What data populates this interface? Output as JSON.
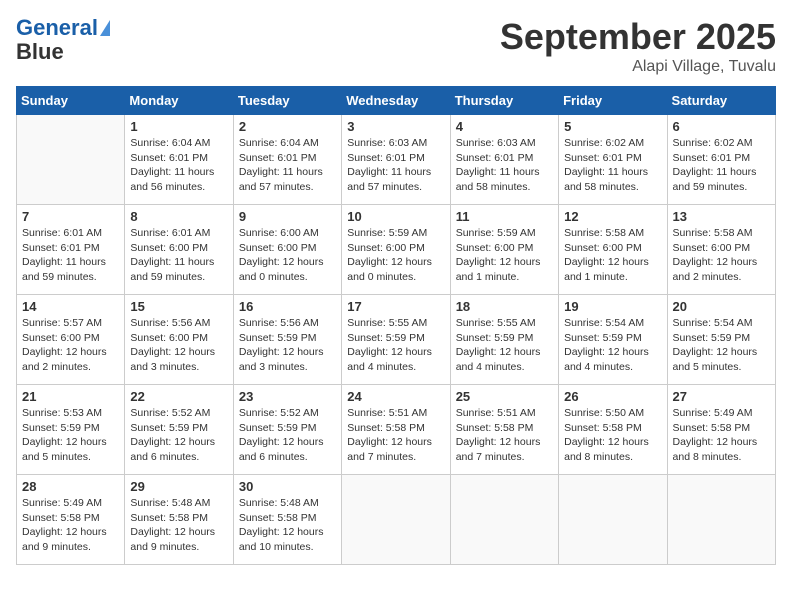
{
  "header": {
    "logo_line1": "General",
    "logo_line2": "Blue",
    "month": "September 2025",
    "location": "Alapi Village, Tuvalu"
  },
  "weekdays": [
    "Sunday",
    "Monday",
    "Tuesday",
    "Wednesday",
    "Thursday",
    "Friday",
    "Saturday"
  ],
  "weeks": [
    [
      {
        "day": null,
        "info": null
      },
      {
        "day": "1",
        "info": "Sunrise: 6:04 AM\nSunset: 6:01 PM\nDaylight: 11 hours\nand 56 minutes."
      },
      {
        "day": "2",
        "info": "Sunrise: 6:04 AM\nSunset: 6:01 PM\nDaylight: 11 hours\nand 57 minutes."
      },
      {
        "day": "3",
        "info": "Sunrise: 6:03 AM\nSunset: 6:01 PM\nDaylight: 11 hours\nand 57 minutes."
      },
      {
        "day": "4",
        "info": "Sunrise: 6:03 AM\nSunset: 6:01 PM\nDaylight: 11 hours\nand 58 minutes."
      },
      {
        "day": "5",
        "info": "Sunrise: 6:02 AM\nSunset: 6:01 PM\nDaylight: 11 hours\nand 58 minutes."
      },
      {
        "day": "6",
        "info": "Sunrise: 6:02 AM\nSunset: 6:01 PM\nDaylight: 11 hours\nand 59 minutes."
      }
    ],
    [
      {
        "day": "7",
        "info": "Sunrise: 6:01 AM\nSunset: 6:01 PM\nDaylight: 11 hours\nand 59 minutes."
      },
      {
        "day": "8",
        "info": "Sunrise: 6:01 AM\nSunset: 6:00 PM\nDaylight: 11 hours\nand 59 minutes."
      },
      {
        "day": "9",
        "info": "Sunrise: 6:00 AM\nSunset: 6:00 PM\nDaylight: 12 hours\nand 0 minutes."
      },
      {
        "day": "10",
        "info": "Sunrise: 5:59 AM\nSunset: 6:00 PM\nDaylight: 12 hours\nand 0 minutes."
      },
      {
        "day": "11",
        "info": "Sunrise: 5:59 AM\nSunset: 6:00 PM\nDaylight: 12 hours\nand 1 minute."
      },
      {
        "day": "12",
        "info": "Sunrise: 5:58 AM\nSunset: 6:00 PM\nDaylight: 12 hours\nand 1 minute."
      },
      {
        "day": "13",
        "info": "Sunrise: 5:58 AM\nSunset: 6:00 PM\nDaylight: 12 hours\nand 2 minutes."
      }
    ],
    [
      {
        "day": "14",
        "info": "Sunrise: 5:57 AM\nSunset: 6:00 PM\nDaylight: 12 hours\nand 2 minutes."
      },
      {
        "day": "15",
        "info": "Sunrise: 5:56 AM\nSunset: 6:00 PM\nDaylight: 12 hours\nand 3 minutes."
      },
      {
        "day": "16",
        "info": "Sunrise: 5:56 AM\nSunset: 5:59 PM\nDaylight: 12 hours\nand 3 minutes."
      },
      {
        "day": "17",
        "info": "Sunrise: 5:55 AM\nSunset: 5:59 PM\nDaylight: 12 hours\nand 4 minutes."
      },
      {
        "day": "18",
        "info": "Sunrise: 5:55 AM\nSunset: 5:59 PM\nDaylight: 12 hours\nand 4 minutes."
      },
      {
        "day": "19",
        "info": "Sunrise: 5:54 AM\nSunset: 5:59 PM\nDaylight: 12 hours\nand 4 minutes."
      },
      {
        "day": "20",
        "info": "Sunrise: 5:54 AM\nSunset: 5:59 PM\nDaylight: 12 hours\nand 5 minutes."
      }
    ],
    [
      {
        "day": "21",
        "info": "Sunrise: 5:53 AM\nSunset: 5:59 PM\nDaylight: 12 hours\nand 5 minutes."
      },
      {
        "day": "22",
        "info": "Sunrise: 5:52 AM\nSunset: 5:59 PM\nDaylight: 12 hours\nand 6 minutes."
      },
      {
        "day": "23",
        "info": "Sunrise: 5:52 AM\nSunset: 5:59 PM\nDaylight: 12 hours\nand 6 minutes."
      },
      {
        "day": "24",
        "info": "Sunrise: 5:51 AM\nSunset: 5:58 PM\nDaylight: 12 hours\nand 7 minutes."
      },
      {
        "day": "25",
        "info": "Sunrise: 5:51 AM\nSunset: 5:58 PM\nDaylight: 12 hours\nand 7 minutes."
      },
      {
        "day": "26",
        "info": "Sunrise: 5:50 AM\nSunset: 5:58 PM\nDaylight: 12 hours\nand 8 minutes."
      },
      {
        "day": "27",
        "info": "Sunrise: 5:49 AM\nSunset: 5:58 PM\nDaylight: 12 hours\nand 8 minutes."
      }
    ],
    [
      {
        "day": "28",
        "info": "Sunrise: 5:49 AM\nSunset: 5:58 PM\nDaylight: 12 hours\nand 9 minutes."
      },
      {
        "day": "29",
        "info": "Sunrise: 5:48 AM\nSunset: 5:58 PM\nDaylight: 12 hours\nand 9 minutes."
      },
      {
        "day": "30",
        "info": "Sunrise: 5:48 AM\nSunset: 5:58 PM\nDaylight: 12 hours\nand 10 minutes."
      },
      {
        "day": null,
        "info": null
      },
      {
        "day": null,
        "info": null
      },
      {
        "day": null,
        "info": null
      },
      {
        "day": null,
        "info": null
      }
    ]
  ]
}
